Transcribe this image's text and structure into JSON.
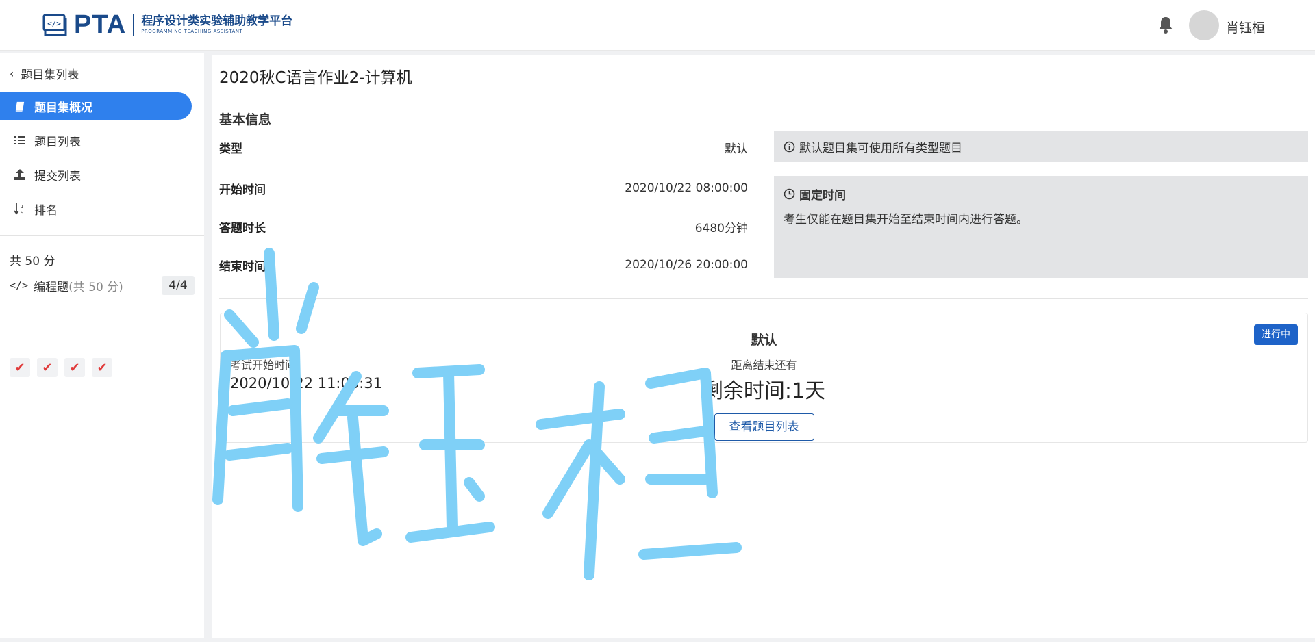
{
  "header": {
    "logo_pta": "PTA",
    "logo_cn": "程序设计类实验辅助教学平台",
    "logo_en": "PROGRAMMING TEACHING ASSISTANT",
    "username": "肖钰桓",
    "bell_icon": "bell-icon"
  },
  "sidebar": {
    "back_label": "题目集列表",
    "items": [
      {
        "label": "题目集概况",
        "icon": "book-icon",
        "active": true
      },
      {
        "label": "题目列表",
        "icon": "list-icon",
        "active": false
      },
      {
        "label": "提交列表",
        "icon": "upload-icon",
        "active": false
      },
      {
        "label": "排名",
        "icon": "sort-icon",
        "active": false
      }
    ],
    "total": "共 50 分",
    "programming": {
      "label": "编程题",
      "sub": "(共 50 分)",
      "count": "4/4"
    },
    "checks": [
      "✔",
      "✔",
      "✔",
      "✔"
    ]
  },
  "main": {
    "title": "2020秋C语言作业2-计算机",
    "section_title": "基本信息",
    "info": {
      "type_label": "类型",
      "type_value": "默认",
      "start_label": "开始时间",
      "start_value": "2020/10/22 08:00:00",
      "duration_label": "答题时长",
      "duration_value": "6480分钟",
      "end_label": "结束时间",
      "end_value": "2020/10/26 20:00:00"
    },
    "type_note": "默认题目集可使用所有类型题目",
    "time_note": {
      "title": "固定时间",
      "body": "考生仅能在题目集开始至结束时间内进行答题。"
    },
    "card": {
      "title": "默认",
      "status": "进行中",
      "left_label": "考试开始时间",
      "left_value": "2020/10/22 11:06:31",
      "center_label": "距离结束还有",
      "remaining": "剩余时间:1天",
      "button": "查看题目列表"
    }
  },
  "colors": {
    "accent": "#2f80ed",
    "badge": "#1e63c8",
    "brand": "#1a4a8a",
    "check": "#e03a3a",
    "signature": "#7fd0f7"
  },
  "overlay": {
    "signature_text": "肖钰桓"
  }
}
